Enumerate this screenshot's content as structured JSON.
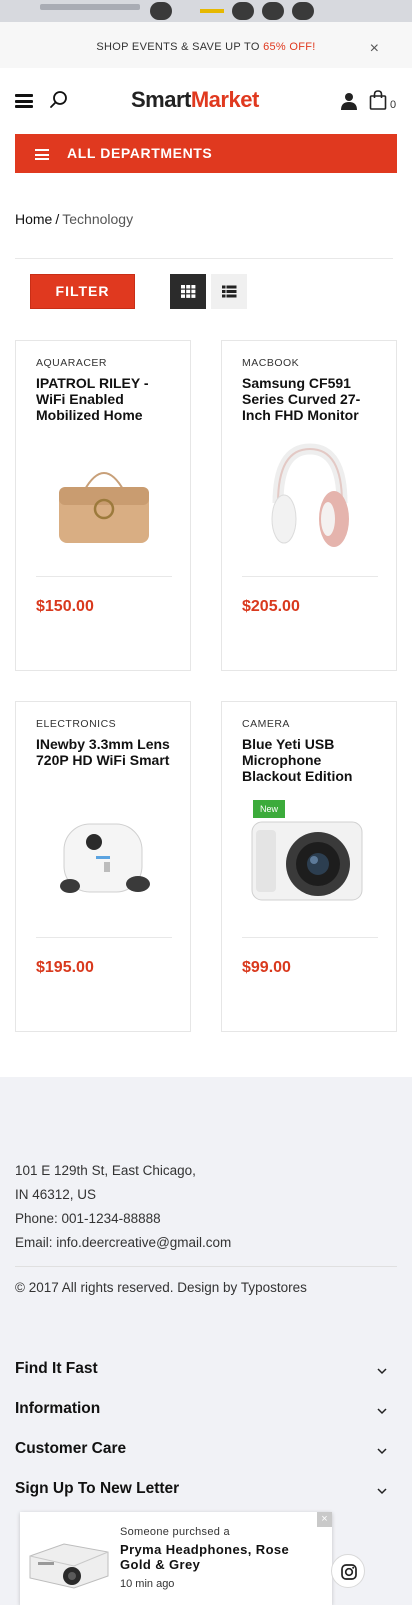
{
  "promo": {
    "text_prefix": "SHOP EVENTS & SAVE UP TO ",
    "text_highlight": "65% OFF!",
    "close": "×"
  },
  "header": {
    "logo_part1": "Smart",
    "logo_part2": "Market",
    "cart_count": "0",
    "icons": [
      "menu-icon",
      "search-icon",
      "user-icon",
      "shopping-bag-icon"
    ]
  },
  "departments": {
    "label": "ALL DEPARTMENTS"
  },
  "breadcrumb": {
    "home": "Home",
    "separator": "/",
    "current": "Technology"
  },
  "toolbar": {
    "filter_label": "FILTER",
    "views": [
      "grid-view-icon",
      "list-view-icon"
    ],
    "active_view": "grid"
  },
  "products": [
    {
      "category": "AQUARACER",
      "title": "IPATROL RILEY - WiFi Enabled Mobilized Home",
      "price": "$150.00",
      "image": "beige-bag"
    },
    {
      "category": "MACBOOK",
      "title": "Samsung CF591 Series Curved 27-Inch FHD Monitor",
      "price": "$205.00",
      "image": "pink-headphones"
    },
    {
      "category": "ELECTRONICS",
      "title": "INewby 3.3mm Lens 720P HD WiFi Smart",
      "price": "$195.00",
      "image": "white-robot-camera"
    },
    {
      "category": "CAMERA",
      "title": "Blue Yeti USB Microphone Blackout Edition",
      "price": "$99.00",
      "badge": "New",
      "image": "white-mirrorless-camera"
    }
  ],
  "footer": {
    "address_line1": "101 E 129th St, East Chicago,",
    "address_line2": "IN 46312, US",
    "phone": "Phone: 001-1234-88888",
    "email": "Email: info.deercreative@gmail.com",
    "copyright": "© 2017 All rights reserved. Design by Typostores",
    "accordions": [
      "Find It Fast",
      "Information",
      "Customer Care",
      "Sign Up To New Letter"
    ]
  },
  "sales_popup": {
    "line1": "Someone purchsed a",
    "product": "Pryma Headphones, Rose Gold & Grey",
    "time": "10 min ago",
    "close": "×"
  },
  "colors": {
    "accent": "#e0391f",
    "price": "#d9391d",
    "badge": "#3cab3b",
    "footer_bg": "#f1f2f6"
  }
}
